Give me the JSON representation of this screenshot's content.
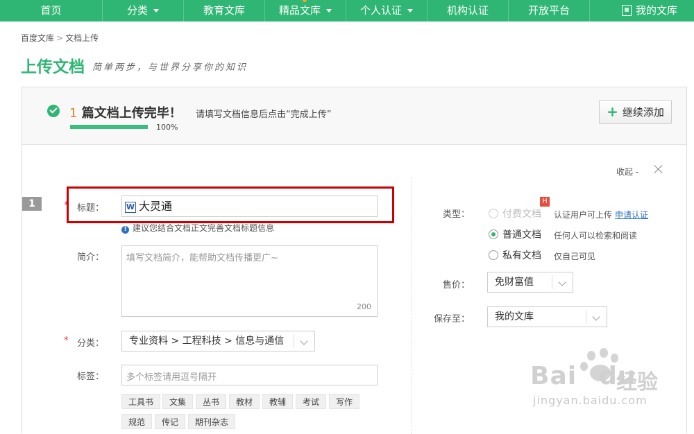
{
  "nav": {
    "items": [
      {
        "label": "首页"
      },
      {
        "label": "分类"
      },
      {
        "label": "教育文库"
      },
      {
        "label": "精品文库"
      },
      {
        "label": "个人认证"
      },
      {
        "label": "机构认证"
      },
      {
        "label": "开放平台"
      }
    ],
    "my_library": "我的文库"
  },
  "breadcrumb": {
    "root": "百度文库",
    "sep": ">",
    "current": "文档上传"
  },
  "page_title": "上传文档",
  "slogan": "简单两步，与世界分享你的知识",
  "status": {
    "count": "1",
    "title": "篇文档上传完毕！",
    "hint": "请填写文档信息后点击“完成上传”",
    "progress": 1.0,
    "progress_text": "100%",
    "add_button": "继续添加"
  },
  "form": {
    "collapse_label": "收起",
    "collapse_dash": "-",
    "row_number": "1",
    "required_mark": "*",
    "title_label": "标题：",
    "title_value": "大灵通",
    "title_file_icon": "W",
    "title_tip": "建议您结合文档正文完善文档标题信息",
    "desc_label": "简介：",
    "desc_placeholder": "填写文档简介，能帮助文档传播更广~",
    "desc_counter": "200",
    "category_label": "分类：",
    "category_value": "专业资料 > 工程科技 > 信息与通信",
    "tags_label": "标签：",
    "tags_placeholder": "多个标签请用逗号隔开",
    "tag_suggestions": [
      "工具书",
      "文集",
      "丛书",
      "教材",
      "教辅",
      "考试",
      "写作",
      "规范",
      "传记",
      "期刊杂志"
    ]
  },
  "side": {
    "type_label": "类型：",
    "options": [
      {
        "label": "付费文档",
        "desc": "认证用户可上传",
        "link": "申请认证",
        "badge": "H",
        "state": "disabled"
      },
      {
        "label": "普通文档",
        "desc": "任何人可以检索和阅读",
        "state": "checked"
      },
      {
        "label": "私有文档",
        "desc": "仅自己可见",
        "state": "unchecked"
      }
    ],
    "price_label": "售价：",
    "price_value": "免财富值",
    "save_label": "保存至：",
    "save_value": "我的文库"
  },
  "watermark": {
    "brand": "Bai",
    "brand2": "du",
    "cn": "经验",
    "url": "jingyan.baidu.com"
  },
  "colors": {
    "brand_green": "#2fb674",
    "accent_orange": "#e0801f",
    "highlight_red": "#cc0000",
    "link_blue": "#2a72c0"
  }
}
